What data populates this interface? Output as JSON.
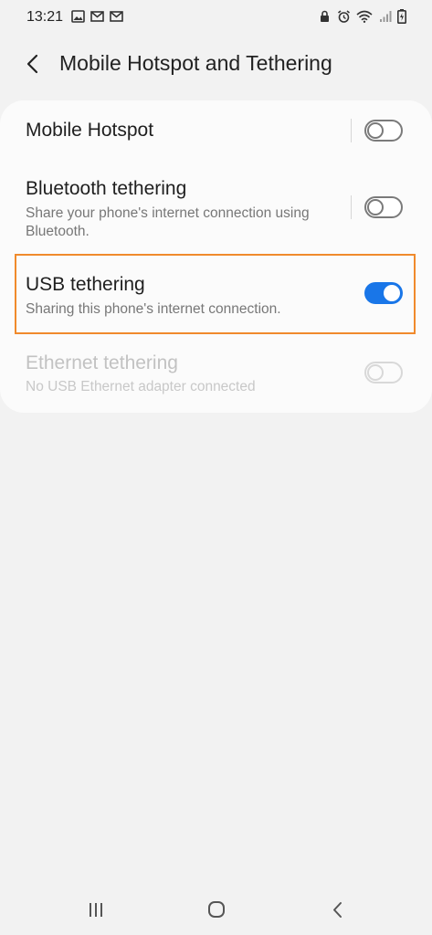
{
  "status_bar": {
    "time": "13:21",
    "left_icons": [
      "image-icon",
      "mail-icon",
      "mail-icon"
    ],
    "right_icons": [
      "lock-icon",
      "alarm-icon",
      "wifi-icon",
      "signal-icon",
      "battery-charging-icon"
    ]
  },
  "header": {
    "title": "Mobile Hotspot and Tethering"
  },
  "settings": {
    "mobile_hotspot": {
      "title": "Mobile Hotspot",
      "enabled": false
    },
    "bluetooth_tethering": {
      "title": "Bluetooth tethering",
      "subtitle": "Share your phone's internet connection using Bluetooth.",
      "enabled": false
    },
    "usb_tethering": {
      "title": "USB tethering",
      "subtitle": "Sharing this phone's internet connection.",
      "enabled": true
    },
    "ethernet_tethering": {
      "title": "Ethernet tethering",
      "subtitle": "No USB Ethernet adapter connected",
      "enabled": false,
      "disabled": true
    }
  },
  "colors": {
    "accent": "#1976e8",
    "highlight": "#f08a2c",
    "background": "#f2f2f2",
    "card": "#fbfbfb"
  },
  "nav_bar": [
    "recents-icon",
    "home-icon",
    "back-icon"
  ]
}
